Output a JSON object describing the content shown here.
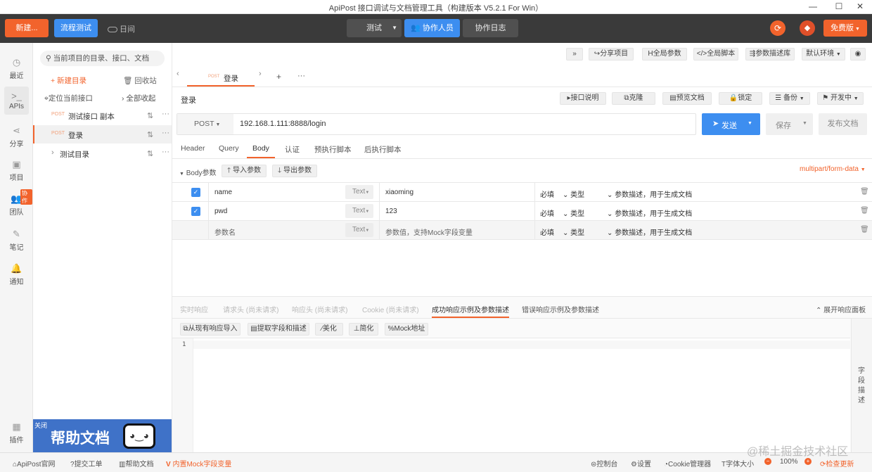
{
  "window": {
    "title": "ApiPost 接口调试与文档管理工具（构建版本 V5.2.1 For Win）",
    "min_icon": "—",
    "max_icon": "☐",
    "close_icon": "✕"
  },
  "toolbar": {
    "new_label": "新建...",
    "flow_test_label": "流程测试",
    "diary_label": "日间",
    "test_label": "测试",
    "collaborators_label": "协作人员",
    "collab_log_label": "协作日志",
    "plan_label": "免费版"
  },
  "rail": {
    "recent": "最近",
    "apis": "APIs",
    "share": "分享",
    "project": "项目",
    "team": "团队",
    "team_badge": "协作",
    "notes": "笔记",
    "notify": "通知",
    "plugins": "插件"
  },
  "sidebar": {
    "search_placeholder": "当前项目的目录、接口、文档",
    "new_dir": "+ 新建目录",
    "recycle": "回收站",
    "locate": "定位当前接口",
    "collapse_all": "全部收起",
    "items": [
      {
        "method": "POST",
        "name": "测试接口 副本"
      },
      {
        "method": "POST",
        "name": "登录"
      },
      {
        "method": "",
        "name": "测试目录"
      }
    ],
    "promo_close": "关闭",
    "promo_title": "帮助文档"
  },
  "main": {
    "top_actions": [
      "»",
      "分享项目",
      "全局参数",
      "全局脚本",
      "参数描述库",
      "默认环境",
      "◉"
    ],
    "tab_method": "POST",
    "tab_name": "登录",
    "tab_add": "+",
    "tab_more": "···",
    "title": "登录",
    "title_actions": [
      "接口说明",
      "克隆",
      "预览文档",
      "锁定",
      "备份",
      "开发中"
    ],
    "method": "POST",
    "url": "192.168.1.111:8888/login",
    "send_label": "发送",
    "save_label": "保存",
    "publish_label": "发布文档",
    "req_tabs": [
      "Header",
      "Query",
      "Body",
      "认证",
      "预执行脚本",
      "后执行脚本"
    ],
    "active_req_tab": "Body",
    "body_params_label": "Body参数",
    "import_params": "导入参数",
    "export_params": "导出参数",
    "content_type": "multipart/form-data",
    "params": [
      {
        "checked": true,
        "name": "name",
        "type": "Text",
        "value": "xiaoming",
        "required": "必填",
        "kind": "类型",
        "desc": "参数描述，用于生成文档"
      },
      {
        "checked": true,
        "name": "pwd",
        "type": "Text",
        "value": "123",
        "required": "必填",
        "kind": "类型",
        "desc": "参数描述，用于生成文档"
      },
      {
        "checked": false,
        "name": "参数名",
        "type": "Text",
        "value": "参数值，支持Mock字段变量",
        "required": "必填",
        "kind": "类型",
        "desc": "参数描述，用于生成文档"
      }
    ],
    "resp_tabs": [
      "实时响应",
      "请求头 (尚未请求)",
      "响应头 (尚未请求)",
      "Cookie (尚未请求)",
      "成功响应示例及参数描述",
      "错误响应示例及参数描述"
    ],
    "active_resp_tab": "成功响应示例及参数描述",
    "expand_panel": "展开响应面板",
    "resp_tools": [
      "从现有响应导入",
      "提取字段和描述",
      "美化",
      "简化",
      "Mock地址"
    ],
    "line_no": "1",
    "side_label": "字段描述"
  },
  "statusbar": {
    "left": [
      "ApiPost官网",
      "提交工单",
      "帮助文档",
      "内置Mock字段变量"
    ],
    "right": [
      "控制台",
      "设置",
      "Cookie管理器",
      "字体大小",
      "100%",
      "检查更新"
    ],
    "watermark": "@稀土掘金技术社区"
  },
  "colors": {
    "accent": "#f2632c",
    "blue": "#3d8ef0",
    "toolbar": "#3a3a3a"
  }
}
